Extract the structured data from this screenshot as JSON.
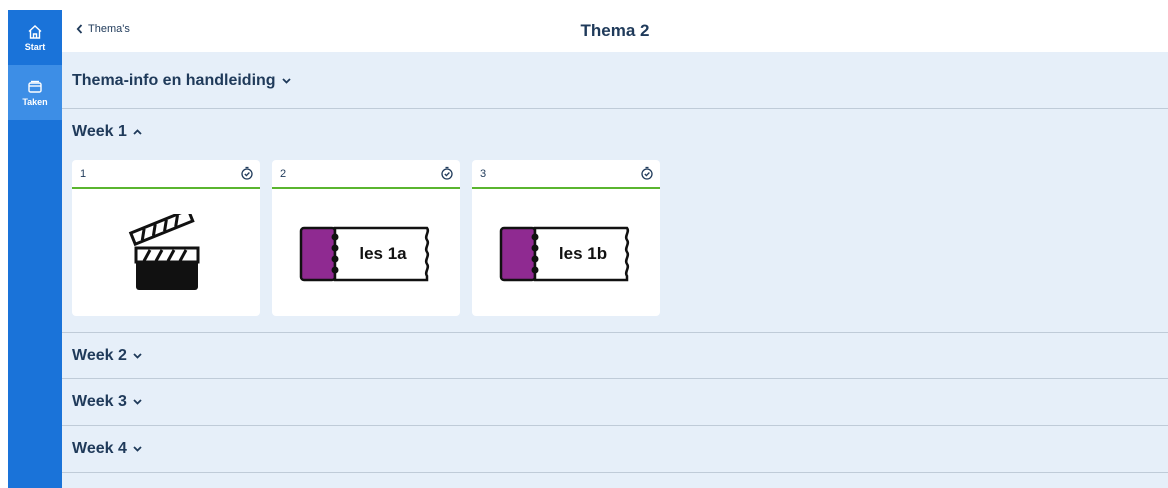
{
  "sidebar": {
    "items": [
      {
        "label": "Start",
        "icon": "home-icon"
      },
      {
        "label": "Taken",
        "icon": "tasks-icon"
      }
    ]
  },
  "header": {
    "back_label": "Thema's",
    "title": "Thema 2"
  },
  "sections": {
    "info": {
      "label": "Thema-info en handleiding"
    },
    "week1": {
      "label": "Week 1",
      "cards": [
        {
          "number": "1",
          "icon": "clapperboard-icon"
        },
        {
          "number": "2",
          "text": "les 1a"
        },
        {
          "number": "3",
          "text": "les 1b"
        }
      ]
    },
    "week2": {
      "label": "Week 2"
    },
    "week3": {
      "label": "Week 3"
    },
    "week4": {
      "label": "Week 4"
    }
  },
  "colors": {
    "sidebar": "#1a73d9",
    "sidebar_active": "#3d8ee6",
    "content_bg": "#e6eff9",
    "text": "#1f3a5a",
    "card_divider": "#5ab52f",
    "ticket_stub": "#8f2a91"
  }
}
